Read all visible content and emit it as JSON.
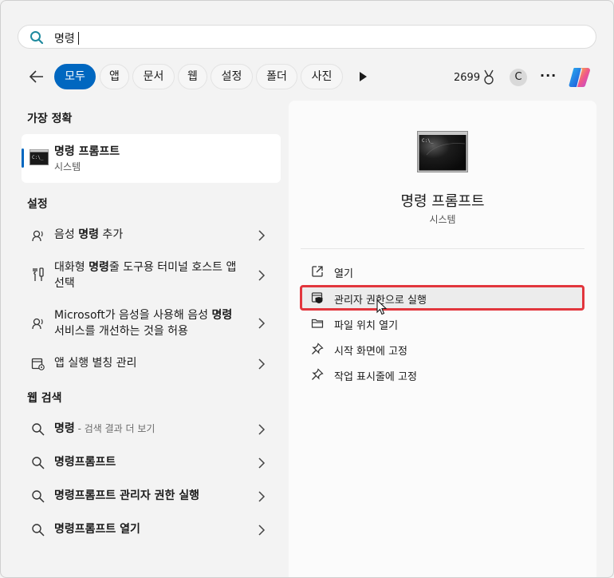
{
  "search": {
    "query": "명령"
  },
  "filters": [
    "모두",
    "앱",
    "문서",
    "웹",
    "설정",
    "폴더",
    "사진"
  ],
  "header": {
    "points": "2699",
    "avatar_letter": "C"
  },
  "best_match": {
    "section": "가장 정확",
    "title": "명령 프롬프트",
    "subtitle": "시스템"
  },
  "settings": {
    "section": "설정",
    "items": [
      {
        "pre": "음성 ",
        "hl": "명령",
        "post": " 추가"
      },
      {
        "pre": "대화형 ",
        "hl": "명령",
        "post": "줄 도구용 터미널 호스트 앱 선택"
      },
      {
        "pre": "Microsoft가 음성을 사용해 음성 ",
        "hl": "명령",
        "post": " 서비스를 개선하는 것을 허용"
      },
      {
        "pre": "앱 실행 별칭 관리",
        "hl": "",
        "post": ""
      }
    ]
  },
  "web": {
    "section": "웹 검색",
    "items": [
      {
        "bold": "명령",
        "suffix": " - 검색 결과 더 보기"
      },
      {
        "bold": "명령프롬프트",
        "suffix": ""
      },
      {
        "bold": "명령프롬프트 관리자 권한 실행",
        "suffix": ""
      },
      {
        "bold": "명령프롬프트 열기",
        "suffix": ""
      }
    ]
  },
  "detail": {
    "title": "명령 프롬프트",
    "subtitle": "시스템",
    "actions": [
      "열기",
      "관리자 권한으로 실행",
      "파일 위치 열기",
      "시작 화면에 고정",
      "작업 표시줄에 고정"
    ]
  },
  "colors": {
    "accent": "#0067c0",
    "highlight_box": "#e2363d"
  }
}
